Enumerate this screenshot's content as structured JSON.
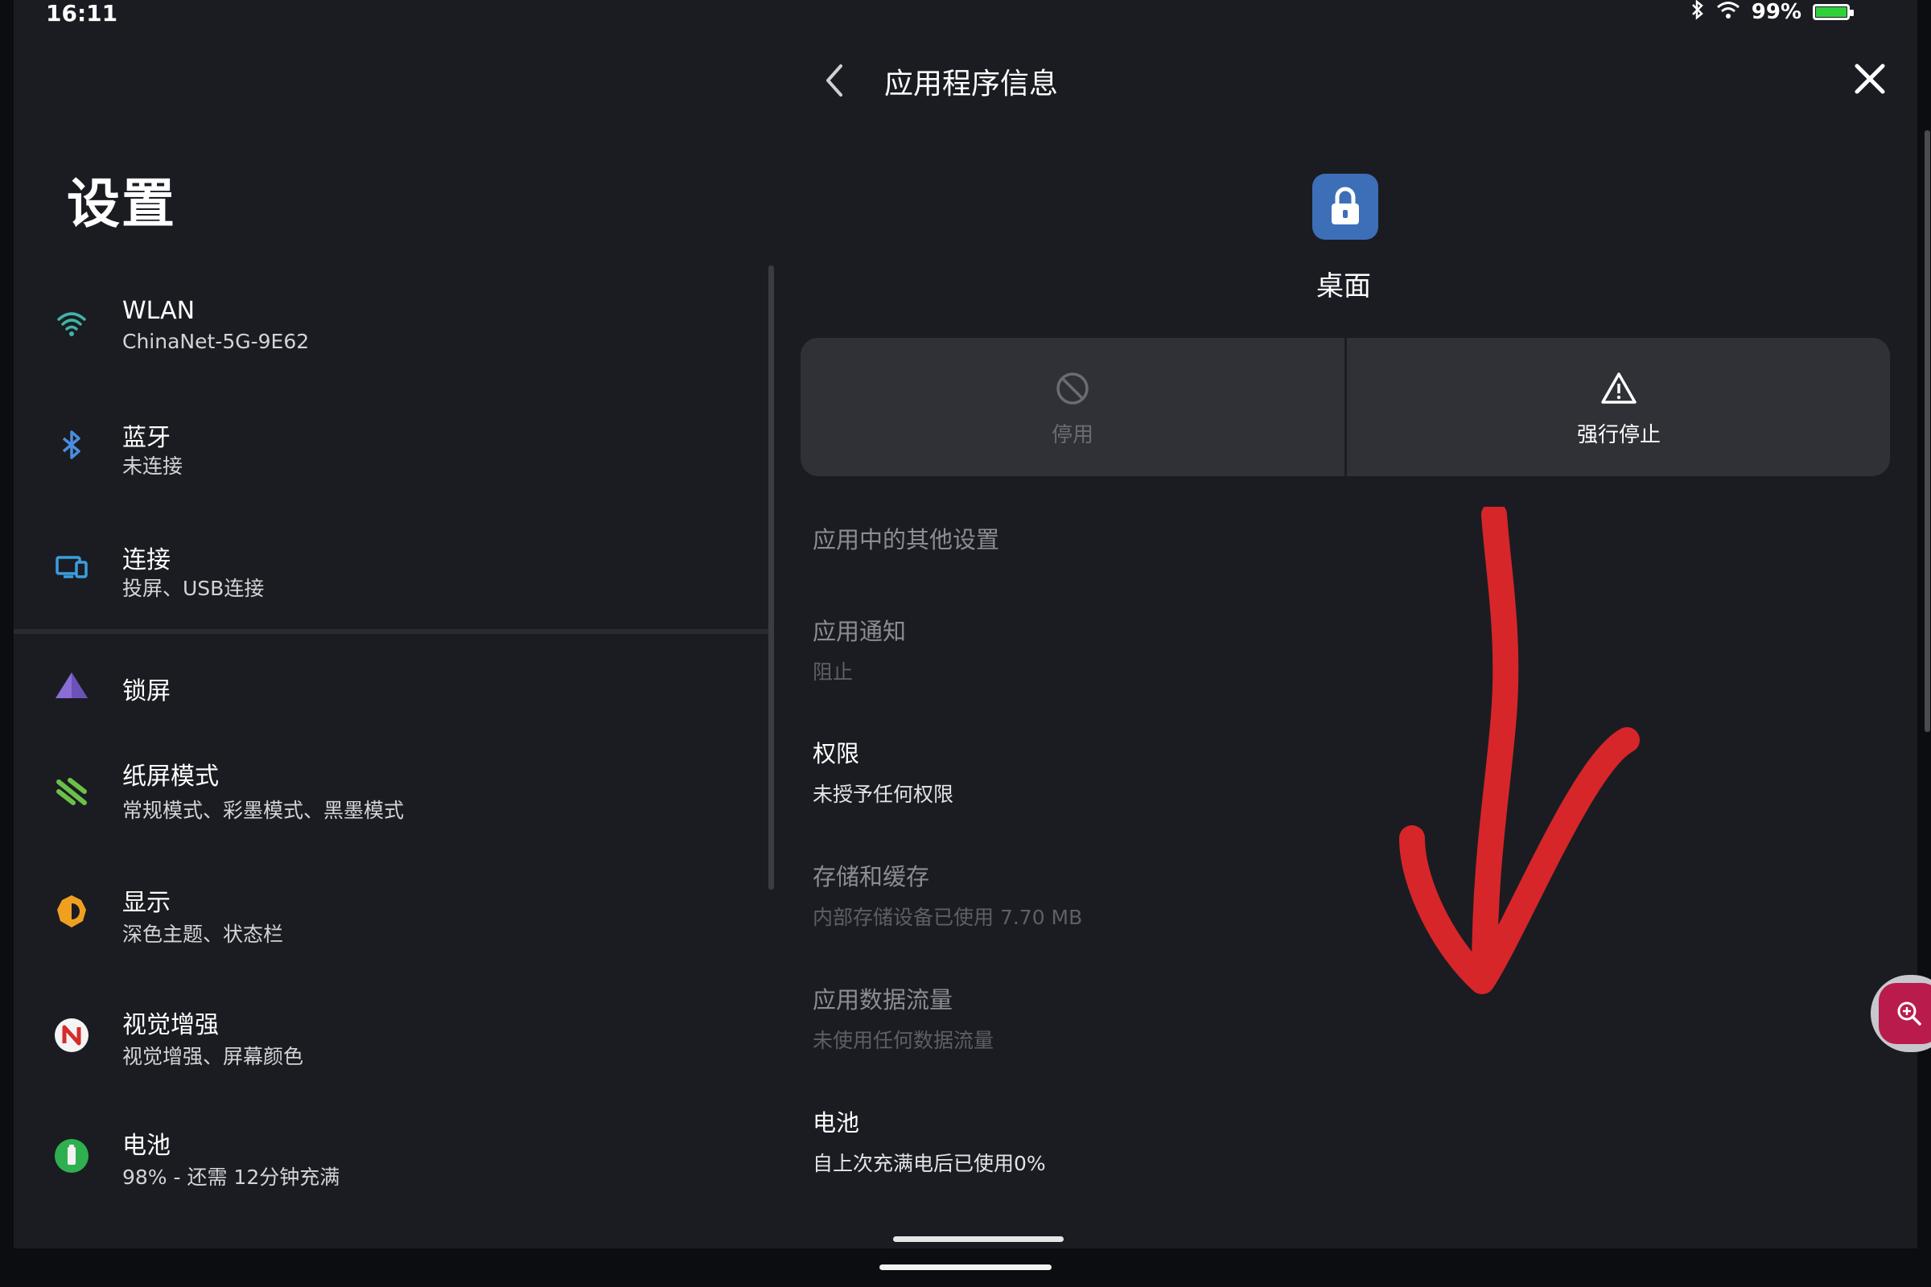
{
  "status_bar": {
    "time": "16:11",
    "battery": "99%",
    "battery_level": 0.99
  },
  "sidebar": {
    "title": "设置",
    "items": [
      {
        "title": "WLAN",
        "subtitle": "ChinaNet-5G-9E62",
        "icon": "wifi-icon"
      },
      {
        "title": "蓝牙",
        "subtitle": "未连接",
        "icon": "bluetooth-icon"
      },
      {
        "title": "连接",
        "subtitle": "投屏、USB连接",
        "icon": "connection-devices-icon"
      },
      {
        "title": "锁屏",
        "subtitle": "",
        "icon": "lock-screen-triangle-icon"
      },
      {
        "title": "纸屏模式",
        "subtitle": "常规模式、彩墨模式、黑墨模式",
        "icon": "paper-mode-icon"
      },
      {
        "title": "显示",
        "subtitle": "深色主题、状态栏",
        "icon": "display-brightness-icon"
      },
      {
        "title": "视觉增强",
        "subtitle": "视觉增强、屏幕颜色",
        "icon": "visual-enhancement-icon"
      },
      {
        "title": "电池",
        "subtitle": "98% - 还需 12分钟充满",
        "icon": "battery-icon"
      }
    ]
  },
  "app_info": {
    "page_title": "应用程序信息",
    "app_name": "桌面",
    "app_icon": "lock-app-icon",
    "actions": {
      "disable_label": "停用",
      "force_stop_label": "强行停止"
    },
    "rows": [
      {
        "title": "应用中的其他设置",
        "subtitle": ""
      },
      {
        "title": "应用通知",
        "subtitle": "阻止"
      },
      {
        "title": "权限",
        "subtitle": "未授予任何权限"
      },
      {
        "title": "存储和缓存",
        "subtitle": "内部存储设备已使用 7.70 MB"
      },
      {
        "title": "应用数据流量",
        "subtitle": "未使用任何数据流量"
      },
      {
        "title": "电池",
        "subtitle": "自上次充满电后已使用0%"
      }
    ]
  },
  "colors": {
    "background": "#1b1c21",
    "card": "#303136",
    "annotation_arrow": "#d6262a",
    "zoom_button": "#b91c4c"
  }
}
